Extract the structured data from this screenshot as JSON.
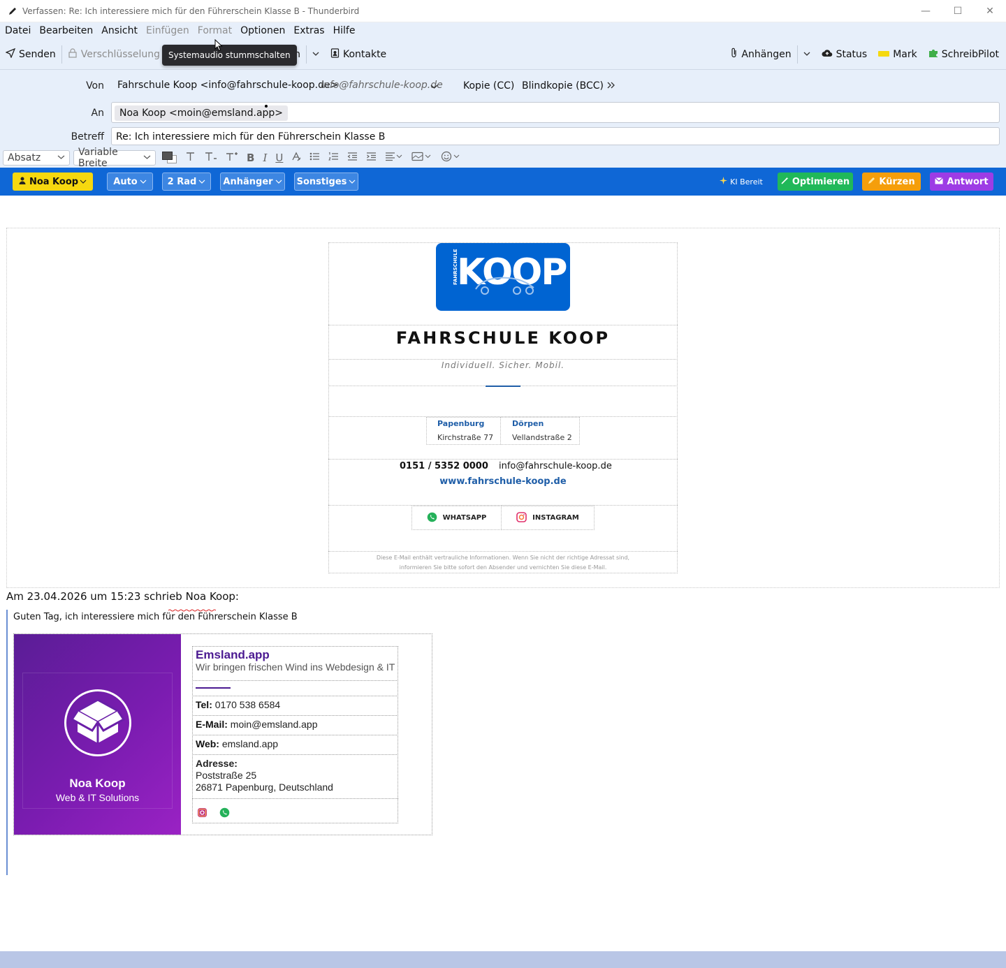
{
  "window": {
    "title": "Verfassen: Re: Ich interessiere mich für den Führerschein Klasse B - Thunderbird",
    "controls": [
      "—",
      "☐",
      "✕"
    ]
  },
  "menu": [
    "Datei",
    "Bearbeiten",
    "Ansicht",
    "Einfügen",
    "Format",
    "Optionen",
    "Extras",
    "Hilfe"
  ],
  "toolbar": {
    "send": "Senden",
    "encryption": "Verschlüsselung",
    "save_partial": "ern",
    "contacts": "Kontakte",
    "attach": "Anhängen",
    "status": "Status",
    "mark": "Mark",
    "schreibpilot": "SchreibPilot",
    "tooltip": "Systemaudio stummschalten"
  },
  "header": {
    "from_label": "Von",
    "from_value": "Fahrschule Koop <info@fahrschule-koop.de>",
    "from_identity": "info@fahrschule-koop.de",
    "cc": "Kopie (CC)",
    "bcc": "Blindkopie (BCC)",
    "to_label": "An",
    "to_value": "Noa Koop <moin@emsland.app>",
    "subject_label": "Betreff",
    "subject_value": "Re: Ich interessiere mich für den Führerschein Klasse B"
  },
  "format": {
    "paragraph": "Absatz",
    "font": "Variable Breite"
  },
  "bluebar": {
    "user": "Noa Koop",
    "auto": "Auto",
    "bike": "2 Rad",
    "trailer": "Anhänger",
    "misc": "Sonstiges",
    "ai_ready": "KI Bereit",
    "optimize": "Optimieren",
    "shorten": "Kürzen",
    "answer": "Antwort",
    "colors": {
      "yellow": "#f6d80f",
      "green": "#20b859",
      "orange": "#f59e0b",
      "purple": "#9d3ce5"
    }
  },
  "signature": {
    "logo_text": "KOOP",
    "logo_side": "FAHRSCHULE",
    "name": "FAHRSCHULE KOOP",
    "slogan": "Individuell. Sicher. Mobil.",
    "loc1_name": "Papenburg",
    "loc1_addr": "Kirchstraße 77",
    "loc2_name": "Dörpen",
    "loc2_addr": "Vellandstraße 2",
    "phone": "0151 / 5352 0000",
    "email": "info@fahrschule-koop.de",
    "web": "www.fahrschule-koop.de",
    "whatsapp": "WHATSAPP",
    "instagram": "INSTAGRAM",
    "disclaimer1": "Diese E-Mail enthält vertrauliche Informationen. Wenn Sie nicht der richtige Adressat sind,",
    "disclaimer2": "informieren Sie bitte sofort den Absender und vernichten Sie diese E-Mail."
  },
  "quote": {
    "header": "Am 23.04.2026 um 15:23 schrieb Noa Koop:",
    "text": "Guten Tag, ich interessiere mich für den Führerschein Klasse B",
    "card_name": "Noa Koop",
    "card_sub": "Web & IT Solutions",
    "company": "Emsland.app",
    "tagline": "Wir bringen frischen Wind ins Webdesign & IT",
    "tel_label": "Tel:",
    "tel": "0170 538 6584",
    "mail_label": "E-Mail:",
    "mail": "moin@emsland.app",
    "web_label": "Web:",
    "web": "emsland.app",
    "addr_label": "Adresse:",
    "addr1": "Poststraße 25",
    "addr2": "26871 Papenburg, Deutschland"
  }
}
